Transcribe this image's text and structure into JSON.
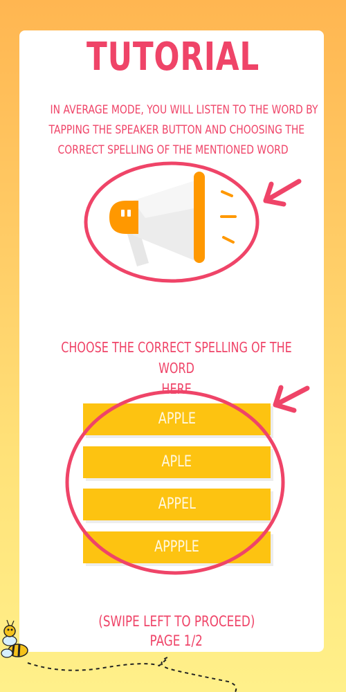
{
  "title": "TUTORIAL",
  "intro": {
    "line1": "In average mode, you will listen to the word by",
    "line2": "tapping the speaker button and choosing the",
    "line3": "correct spelling of the mentioned word"
  },
  "choose_text": {
    "line1": "Choose the correct spelling of the word",
    "line2": "here"
  },
  "options": [
    "APPLE",
    "APLE",
    "APPEL",
    "APPPLE"
  ],
  "footer": {
    "swipe": "(SWIPE LEFT TO PROCEED)",
    "page": "PAGE 1/2"
  },
  "colors": {
    "accent": "#ef4468",
    "option_bg": "#fdc311",
    "speaker_orange": "#ff9800",
    "background_top": "#ffb651",
    "background_bottom": "#fff08a"
  },
  "icons": [
    "speaker-icon",
    "arrow-icon",
    "bee-icon"
  ]
}
